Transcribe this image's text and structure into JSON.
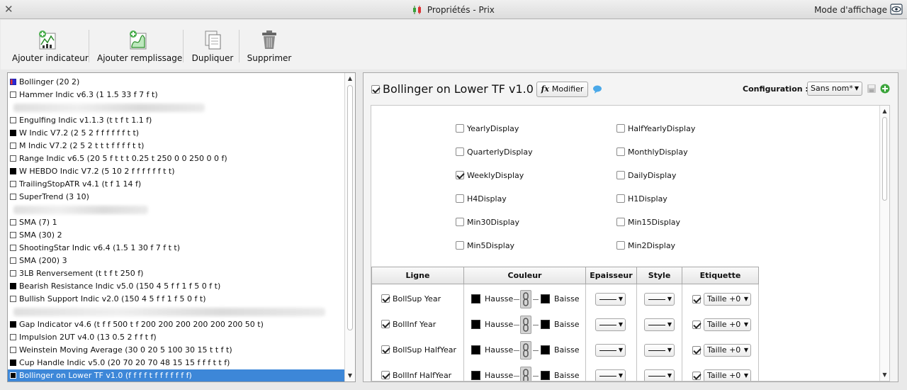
{
  "window": {
    "title": "Propriétés - Prix",
    "view_mode_label": "Mode d'affichage"
  },
  "toolbar": {
    "add_indicator": "Ajouter indicateur",
    "add_fill": "Ajouter remplissage",
    "duplicate": "Dupliquer",
    "delete": "Supprimer"
  },
  "indicators": [
    {
      "label": "Bollinger (20 2)",
      "swatch": "bollinger"
    },
    {
      "label": "Hammer Indic v6.3 (1 1.5 33 f 7 f t)",
      "swatch": "white"
    },
    {
      "label": "",
      "swatch": "blurred"
    },
    {
      "label": "Engulfing Indic v1.1.3 (t t f t 1.1 f)",
      "swatch": "white"
    },
    {
      "label": "W Indic V7.2 (2 5 2 f f f f f f t t)",
      "swatch": "black"
    },
    {
      "label": "M Indic V7.2 (2 5 2 t t t f f f f t t)",
      "swatch": "white"
    },
    {
      "label": "Range Indic v6.5 (20 5 f t t t 0.25 t 250 0 0 250 0 0 f)",
      "swatch": "white"
    },
    {
      "label": "W HEBDO Indic V7.2 (5 10 2 f f f f f f t t)",
      "swatch": "black"
    },
    {
      "label": "TrailingStopATR v4.1 (t f 1 14 f)",
      "swatch": "white"
    },
    {
      "label": "SuperTrend (3 10)",
      "swatch": "white"
    },
    {
      "label": "",
      "swatch": "blurred"
    },
    {
      "label": "SMA (7) 1",
      "swatch": "white"
    },
    {
      "label": "SMA (30) 2",
      "swatch": "white"
    },
    {
      "label": "ShootingStar Indic v6.4 (1.5 1 30 f 7 f t t)",
      "swatch": "white"
    },
    {
      "label": "SMA (200) 3",
      "swatch": "white"
    },
    {
      "label": "3LB Renversement (t t f t 250 f)",
      "swatch": "white"
    },
    {
      "label": "Bearish Resistance Indic v5.0 (150 4 5 f f 1 f 5 0 f t)",
      "swatch": "black"
    },
    {
      "label": "Bullish Support Indic v2.0 (150 4 5 f f 1 f 5 0 f t)",
      "swatch": "white"
    },
    {
      "label": "",
      "swatch": "blurred"
    },
    {
      "label": "Gap Indicator v4.6 (t f f 500 t f 200 200 200 200 200 200 50 t)",
      "swatch": "black"
    },
    {
      "label": "Impulsion 2UT v4.0 (13 0.5 2 f f t f)",
      "swatch": "white"
    },
    {
      "label": "Weinstein Moving Average (30 0 20 5 100 30 15 t t f t)",
      "swatch": "white"
    },
    {
      "label": "Cup Handle Indic v5.0 (20 70 20 70 48 15 15 f f f t t f)",
      "swatch": "black"
    },
    {
      "label": "Bollinger on Lower TF v1.0 (f f f f t f f f f f f f)",
      "swatch": "black",
      "selected": true
    }
  ],
  "details": {
    "indicator_name": "Bollinger on Lower TF v1.0",
    "modify_label": "Modifier",
    "fx_label": "fx",
    "config_label": "Configuration :",
    "config_value": "Sans nom*"
  },
  "display_options": [
    {
      "label": "YearlyDisplay",
      "checked": false
    },
    {
      "label": "HalfYearlyDisplay",
      "checked": false
    },
    {
      "label": "QuarterlyDisplay",
      "checked": false
    },
    {
      "label": "MonthlyDisplay",
      "checked": false
    },
    {
      "label": "WeeklyDisplay",
      "checked": true
    },
    {
      "label": "DailyDisplay",
      "checked": false
    },
    {
      "label": "H4Display",
      "checked": false
    },
    {
      "label": "H1Display",
      "checked": false
    },
    {
      "label": "Min30Display",
      "checked": false
    },
    {
      "label": "Min15Display",
      "checked": false
    },
    {
      "label": "Min5Display",
      "checked": false
    },
    {
      "label": "Min2Display",
      "checked": false
    }
  ],
  "lines_table": {
    "headers": [
      "Ligne",
      "Couleur",
      "Epaisseur",
      "Style",
      "Etiquette"
    ],
    "rows": [
      {
        "name": "BollSup Year",
        "up_label": "Hausse",
        "down_label": "Baisse",
        "label_value": "Taille +0"
      },
      {
        "name": "BollInf Year",
        "up_label": "Hausse",
        "down_label": "Baisse",
        "label_value": "Taille +0"
      },
      {
        "name": "BollSup HalfYear",
        "up_label": "Hausse",
        "down_label": "Baisse",
        "label_value": "Taille +0"
      },
      {
        "name": "BollInf HalfYear",
        "up_label": "Hausse",
        "down_label": "Baisse",
        "label_value": "Taille +0"
      }
    ]
  },
  "colors": {
    "selection": "#3d87d8",
    "line_color": "#000000"
  }
}
